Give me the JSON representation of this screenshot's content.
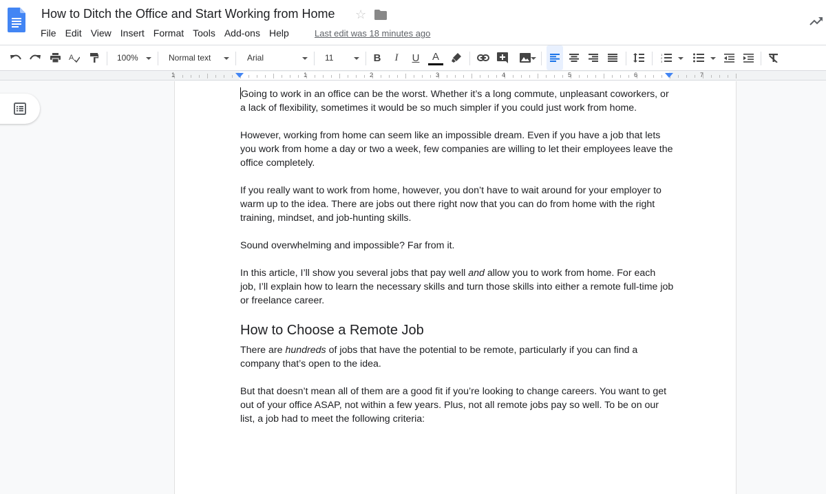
{
  "header": {
    "title": "How to Ditch the Office and Start Working from Home",
    "menu": [
      "File",
      "Edit",
      "View",
      "Insert",
      "Format",
      "Tools",
      "Add-ons",
      "Help"
    ],
    "last_edit": "Last edit was 18 minutes ago",
    "icons": {
      "logo": "google-docs-icon",
      "star": "star-icon",
      "folder": "folder-icon",
      "activity": "trending-up-icon"
    }
  },
  "toolbar": {
    "zoom": "100%",
    "style": "Normal text",
    "font": "Arial",
    "font_size": "11",
    "bold": "B",
    "italic": "I",
    "underline": "U",
    "text_color": "A",
    "text_color_value": "#000000",
    "accent": "#1a73e8"
  },
  "ruler": {
    "labels": [
      "1",
      "1",
      "2",
      "3",
      "4",
      "5",
      "6",
      "7"
    ]
  },
  "document": {
    "paragraphs": [
      "Going to work in an office can be the worst. Whether it’s a long commute, unpleasant coworkers, or a lack of flexibility, sometimes it would be so much simpler if you could just work from home.",
      "However, working from home can seem like an impossible dream. Even if you have a job that lets you work from home a day or two a week, few companies are willing to let their employees leave the office completely.",
      "If you really want to work from home, however, you don’t have to wait around for your employer to warm up to the idea. There are jobs out there right now that you can do from home with the right training, mindset, and job-hunting skills.",
      "Sound overwhelming and impossible? Far from it."
    ],
    "p5": {
      "before": "In this article, I’ll show you several jobs that pay well ",
      "em": "and",
      "after": " allow you to work from home. For each job, I’ll explain how to learn the necessary skills and turn those skills into either a remote full-time job or freelance career."
    },
    "heading": "How to Choose a Remote Job",
    "p6": {
      "before": "There are ",
      "em": "hundreds",
      "after": " of jobs that have the potential to be remote, particularly if you can find a company that’s open to the idea."
    },
    "p7": "But that doesn’t mean all of them are a good fit if you’re looking to change careers. You want to get out of your office ASAP, not within a few years. Plus, not all remote jobs pay so well. To be on our list, a job had to meet the following criteria:"
  }
}
